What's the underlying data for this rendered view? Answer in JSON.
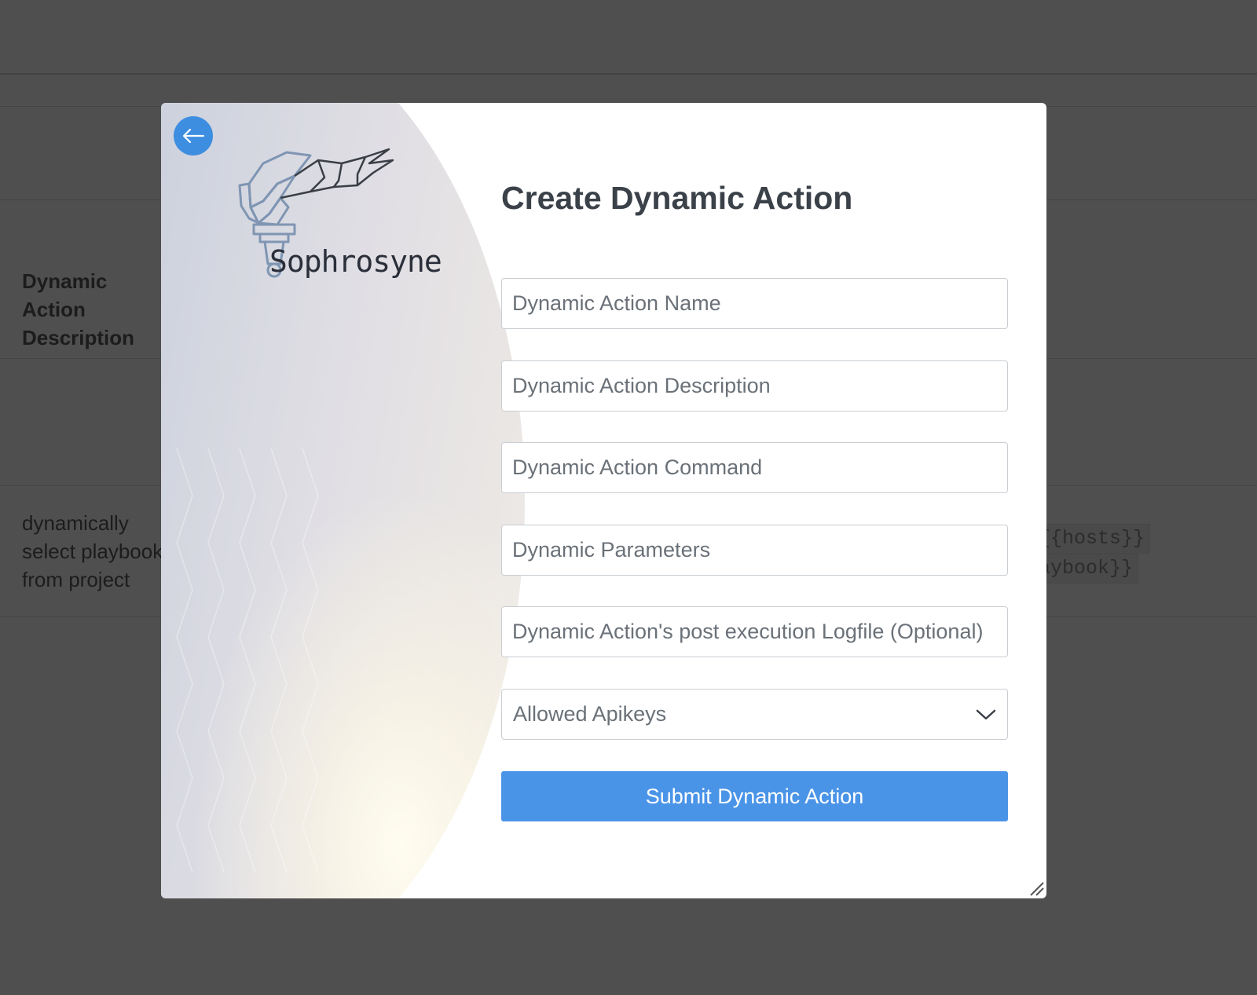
{
  "background": {
    "table_header": "Dynamic Action Description",
    "row_description": "dynamically select playbook from project",
    "code_lines": [
      "/{{hosts}}",
      "laybook}}"
    ]
  },
  "modal": {
    "brand_name": "Sophrosyne",
    "title": "Create Dynamic Action",
    "fields": {
      "name_placeholder": "Dynamic Action Name",
      "description_placeholder": "Dynamic Action Description",
      "command_placeholder": "Dynamic Action Command",
      "parameters_placeholder": "Dynamic Parameters",
      "logfile_placeholder": "Dynamic Action's post execution Logfile (Optional)"
    },
    "apikeys_select": {
      "selected": "Allowed Apikeys",
      "icon": "chevron-down-icon"
    },
    "submit_label": "Submit Dynamic Action",
    "back_icon": "arrow-left-icon",
    "accent_color": "#4a94e8"
  }
}
